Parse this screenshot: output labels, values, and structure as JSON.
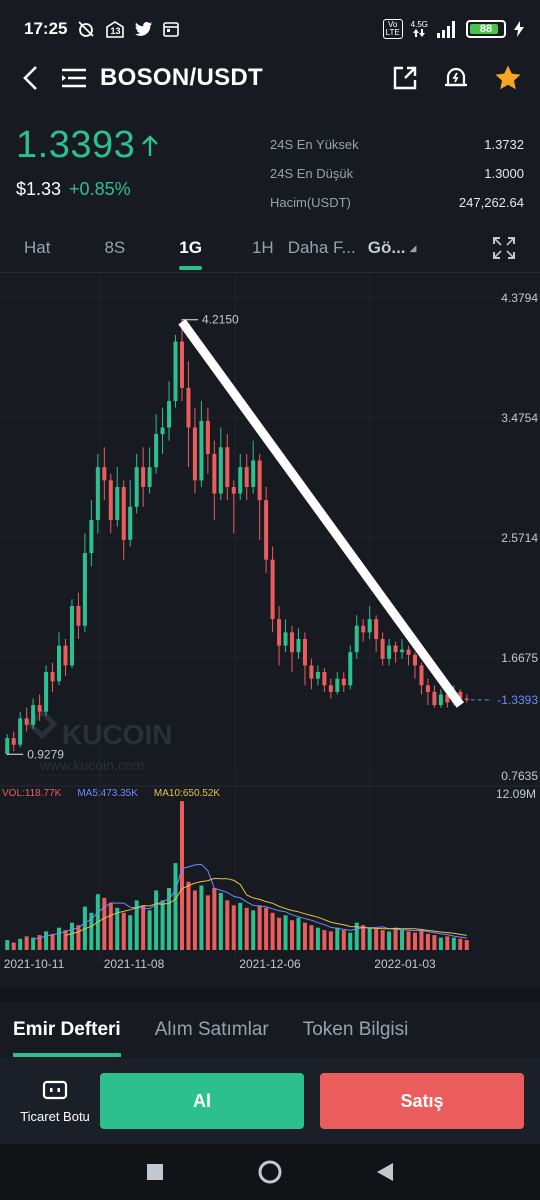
{
  "status_bar": {
    "time": "17:25",
    "badge_count": "13",
    "volte_label": "Vo LTE",
    "network": "4.5G",
    "battery": "88"
  },
  "header": {
    "pair": "BOSON/USDT"
  },
  "price": {
    "last": "1.3393",
    "usd": "$1.33",
    "change": "+0.85%",
    "up_color": "#2cc08f"
  },
  "stats": [
    {
      "label": "24S En Yüksek",
      "value": "1.3732"
    },
    {
      "label": "24S En Düşük",
      "value": "1.3000"
    },
    {
      "label": "Hacim(USDT)",
      "value": "247,262.64"
    }
  ],
  "tabs": {
    "items": [
      "Hat",
      "8S",
      "1G",
      "1H",
      "Daha F..."
    ],
    "active": "1G",
    "indicator_label": "Gö..."
  },
  "chart_data": {
    "type": "candlestick",
    "y_ticks": [
      "4.3794",
      "3.4754",
      "2.5714",
      "1.6675",
      "0.7635"
    ],
    "x_ticks": [
      "2021-10-11",
      "2021-11-08",
      "2021-12-06",
      "2022-01-03"
    ],
    "ylim": [
      0.7635,
      4.3794
    ],
    "high_marker": "4.2150",
    "low_marker": "0.9279",
    "last_price_label": "1.3393",
    "watermark": "KUCOIN",
    "watermark_url": "www.kucoin.com",
    "trendline": {
      "from": [
        27,
        4.2
      ],
      "to": [
        70,
        1.3
      ]
    },
    "up_color": "#2cc08f",
    "down_color": "#eb5d5d",
    "candles": [
      [
        0.93,
        1.05,
        0.92,
        1.08
      ],
      [
        1.05,
        1.0,
        0.95,
        1.1
      ],
      [
        1.0,
        1.2,
        0.98,
        1.25
      ],
      [
        1.2,
        1.15,
        1.1,
        1.28
      ],
      [
        1.15,
        1.3,
        1.12,
        1.35
      ],
      [
        1.3,
        1.25,
        1.18,
        1.38
      ],
      [
        1.25,
        1.55,
        1.22,
        1.6
      ],
      [
        1.55,
        1.48,
        1.4,
        1.62
      ],
      [
        1.48,
        1.75,
        1.45,
        1.85
      ],
      [
        1.75,
        1.6,
        1.52,
        1.8
      ],
      [
        1.6,
        2.05,
        1.58,
        2.1
      ],
      [
        2.05,
        1.9,
        1.8,
        2.15
      ],
      [
        1.9,
        2.45,
        1.85,
        2.6
      ],
      [
        2.45,
        2.7,
        2.35,
        2.85
      ],
      [
        2.7,
        3.1,
        2.6,
        3.2
      ],
      [
        3.1,
        3.0,
        2.85,
        3.25
      ],
      [
        3.0,
        2.7,
        2.6,
        3.05
      ],
      [
        2.7,
        2.95,
        2.65,
        3.1
      ],
      [
        2.95,
        2.55,
        2.4,
        3.0
      ],
      [
        2.55,
        2.8,
        2.5,
        3.0
      ],
      [
        2.8,
        3.1,
        2.75,
        3.2
      ],
      [
        3.1,
        2.95,
        2.8,
        3.25
      ],
      [
        2.95,
        3.1,
        2.9,
        3.25
      ],
      [
        3.1,
        3.35,
        3.05,
        3.5
      ],
      [
        3.35,
        3.4,
        3.2,
        3.55
      ],
      [
        3.4,
        3.6,
        3.3,
        3.75
      ],
      [
        3.6,
        4.05,
        3.55,
        4.1
      ],
      [
        4.05,
        3.7,
        3.6,
        4.22
      ],
      [
        3.7,
        3.4,
        3.1,
        3.9
      ],
      [
        3.4,
        3.0,
        2.9,
        3.55
      ],
      [
        3.0,
        3.45,
        2.95,
        3.6
      ],
      [
        3.45,
        3.2,
        3.05,
        3.55
      ],
      [
        3.2,
        2.9,
        2.7,
        3.3
      ],
      [
        2.9,
        3.25,
        2.85,
        3.4
      ],
      [
        3.25,
        2.95,
        2.85,
        3.35
      ],
      [
        2.95,
        2.9,
        2.6,
        3.0
      ],
      [
        2.9,
        3.1,
        2.85,
        3.2
      ],
      [
        3.1,
        2.95,
        2.85,
        3.2
      ],
      [
        2.95,
        3.15,
        2.9,
        3.3
      ],
      [
        3.15,
        2.85,
        2.55,
        3.2
      ],
      [
        2.85,
        2.4,
        2.3,
        2.95
      ],
      [
        2.4,
        1.95,
        1.85,
        2.5
      ],
      [
        1.95,
        1.75,
        1.6,
        2.05
      ],
      [
        1.75,
        1.85,
        1.7,
        1.95
      ],
      [
        1.85,
        1.7,
        1.55,
        1.9
      ],
      [
        1.7,
        1.8,
        1.65,
        1.88
      ],
      [
        1.8,
        1.6,
        1.45,
        1.85
      ],
      [
        1.6,
        1.5,
        1.42,
        1.65
      ],
      [
        1.5,
        1.55,
        1.45,
        1.6
      ],
      [
        1.55,
        1.45,
        1.4,
        1.58
      ],
      [
        1.45,
        1.4,
        1.35,
        1.5
      ],
      [
        1.4,
        1.5,
        1.38,
        1.55
      ],
      [
        1.5,
        1.45,
        1.4,
        1.55
      ],
      [
        1.45,
        1.7,
        1.42,
        1.75
      ],
      [
        1.7,
        1.9,
        1.65,
        1.98
      ],
      [
        1.9,
        1.85,
        1.78,
        1.95
      ],
      [
        1.85,
        1.95,
        1.8,
        2.05
      ],
      [
        1.95,
        1.8,
        1.7,
        1.98
      ],
      [
        1.8,
        1.65,
        1.6,
        1.85
      ],
      [
        1.65,
        1.75,
        1.6,
        1.8
      ],
      [
        1.75,
        1.7,
        1.62,
        1.78
      ],
      [
        1.7,
        1.72,
        1.65,
        1.8
      ],
      [
        1.72,
        1.68,
        1.6,
        1.75
      ],
      [
        1.68,
        1.6,
        1.5,
        1.7
      ],
      [
        1.6,
        1.45,
        1.38,
        1.62
      ],
      [
        1.45,
        1.4,
        1.3,
        1.5
      ],
      [
        1.4,
        1.3,
        1.28,
        1.45
      ],
      [
        1.3,
        1.38,
        1.28,
        1.42
      ],
      [
        1.38,
        1.32,
        1.28,
        1.4
      ],
      [
        1.32,
        1.4,
        1.3,
        1.45
      ],
      [
        1.4,
        1.35,
        1.32,
        1.42
      ],
      [
        1.35,
        1.34,
        1.32,
        1.38
      ]
    ],
    "volume": {
      "legend_vol": "VOL:118.77K",
      "legend_ma5": "MA5:473.35K",
      "legend_ma10": "MA10:650.52K",
      "max_label": "12.09M",
      "ma5_color": "#6c8cff",
      "ma10_color": "#e3c348",
      "values": [
        0.8,
        0.6,
        0.9,
        1.1,
        1.0,
        1.2,
        1.5,
        1.3,
        1.8,
        1.6,
        2.2,
        2.0,
        3.5,
        3.0,
        4.5,
        4.2,
        3.8,
        3.4,
        3.0,
        2.8,
        4.0,
        3.6,
        3.2,
        4.8,
        4.0,
        5.0,
        7.0,
        12.0,
        5.5,
        4.8,
        5.2,
        4.4,
        5.0,
        4.6,
        4.0,
        3.6,
        3.8,
        3.4,
        3.2,
        3.6,
        3.4,
        3.0,
        2.6,
        2.8,
        2.4,
        2.6,
        2.2,
        2.0,
        1.8,
        1.6,
        1.5,
        1.8,
        1.6,
        1.4,
        2.2,
        2.0,
        1.8,
        1.7,
        1.6,
        1.5,
        1.8,
        1.6,
        1.5,
        1.4,
        1.6,
        1.3,
        1.2,
        1.0,
        1.1,
        1.0,
        0.9,
        0.8
      ],
      "ylim": [
        0,
        12.09
      ]
    }
  },
  "sections": {
    "items": [
      "Emir Defteri",
      "Alım Satımlar",
      "Token Bilgisi"
    ],
    "active": "Emir Defteri"
  },
  "actions": {
    "bot_label": "Ticaret Botu",
    "buy_label": "Al",
    "sell_label": "Satış"
  }
}
